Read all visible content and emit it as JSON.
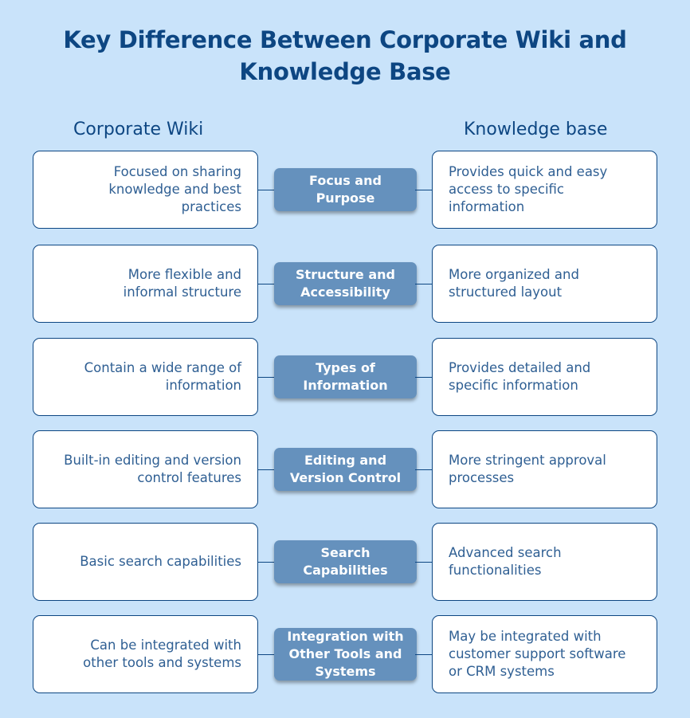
{
  "title": "Key Difference Between Corporate Wiki and Knowledge Base",
  "columns": {
    "left": "Corporate Wiki",
    "right": "Knowledge base"
  },
  "colors": {
    "background": "#c9e3fa",
    "title": "#0d4682",
    "center_box": "#6591bd",
    "body_text": "#2f5f93"
  },
  "rows": [
    {
      "left": "Focused on sharing knowledge and best practices",
      "center": "Focus and Purpose",
      "right": "Provides quick and easy access to specific information"
    },
    {
      "left": "More flexible and informal structure",
      "center": "Structure and Accessibility",
      "right": "More organized and structured layout"
    },
    {
      "left": "Contain a wide range of information",
      "center": "Types of Information",
      "right": "Provides detailed and specific information"
    },
    {
      "left": "Built-in editing and version control features",
      "center": "Editing and Version Control",
      "right": "More stringent approval processes"
    },
    {
      "left": "Basic search capabilities",
      "center": "Search Capabilities",
      "right": "Advanced search functionalities"
    },
    {
      "left": "Can be integrated with other tools and systems",
      "center": "Integration with Other Tools and Systems",
      "right": "May be integrated with customer support software or CRM systems"
    }
  ]
}
